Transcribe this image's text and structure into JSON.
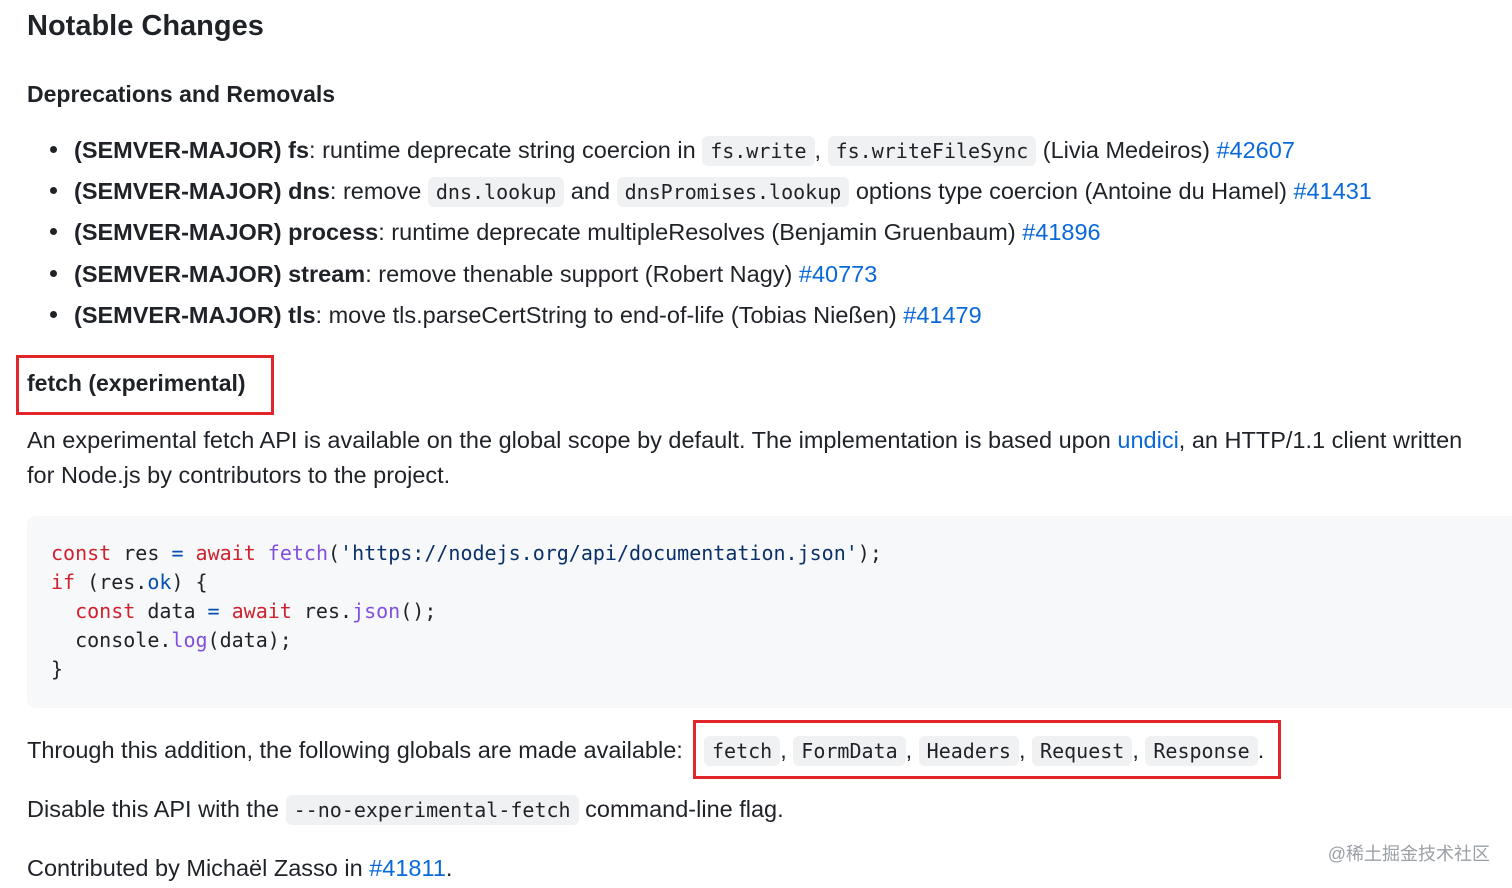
{
  "title": "Notable Changes",
  "subtitle": "Deprecations and Removals",
  "bullets": [
    {
      "tag": "(SEMVER-MAJOR) fs",
      "text1": ": runtime deprecate string coercion in ",
      "code1": "fs.write",
      "sep": ",",
      "code2": "fs.writeFileSync",
      "author": " (Livia Medeiros) ",
      "link": "#42607"
    },
    {
      "tag": "(SEMVER-MAJOR) dns",
      "text1": ": remove ",
      "code1": "dns.lookup",
      "sep": " and ",
      "code2": "dnsPromises.lookup",
      "author": " options type coercion (Antoine du Hamel) ",
      "link": "#41431"
    },
    {
      "tag": "(SEMVER-MAJOR) process",
      "text1": ": runtime deprecate multipleResolves (Benjamin Gruenbaum) ",
      "link": "#41896"
    },
    {
      "tag": "(SEMVER-MAJOR) stream",
      "text1": ": remove thenable support (Robert Nagy) ",
      "link": "#40773"
    },
    {
      "tag": "(SEMVER-MAJOR) tls",
      "text1": ": move tls.parseCertString to end-of-life (Tobias Nießen) ",
      "link": "#41479"
    }
  ],
  "fetch_section": {
    "heading": "fetch (experimental)",
    "para_line1_a": "An experimental fetch API is available on the global scope by default. The implementation is based upon ",
    "para_link": "undici",
    "para_line1_b": ", an HTTP/1.1 client written",
    "para_line2": "for Node.js by contributors to the project.",
    "code": {
      "l1_kw1": "const",
      "l1_var": " res ",
      "l1_eq": "=",
      "l1_kw2": " await",
      "l1_fn": " fetch",
      "l1_p1": "(",
      "l1_str": "'https://nodejs.org/api/documentation.json'",
      "l1_p2": ");",
      "l2_kw": "if",
      "l2_a": " (res.",
      "l2_prop": "ok",
      "l2_b": ") {",
      "l3_kw1": "  const",
      "l3_var": " data ",
      "l3_eq": "=",
      "l3_kw2": " await",
      "l3_a": " res.",
      "l3_fn": "json",
      "l3_b": "();",
      "l4_a": "  console.",
      "l4_fn": "log",
      "l4_b": "(data);",
      "l5": "}"
    },
    "globals_text": "Through this addition, the following globals are made available: ",
    "globals": [
      "fetch",
      "FormData",
      "Headers",
      "Request",
      "Response"
    ],
    "globals_sep": ",",
    "globals_end": ".",
    "disable_a": "Disable this API with the ",
    "disable_code": "--no-experimental-fetch",
    "disable_b": " command-line flag.",
    "contrib_text": "Contributed by Michaël Zasso in ",
    "contrib_link": "#41811",
    "contrib_end": "."
  },
  "watermark": "@稀土掘金技术社区",
  "colors": {
    "link": "#0969da",
    "highlight_box": "#e0262b",
    "code_bg": "#f6f8fa",
    "keyword": "#cf222e",
    "function": "#8250df",
    "string": "#0a3069"
  }
}
